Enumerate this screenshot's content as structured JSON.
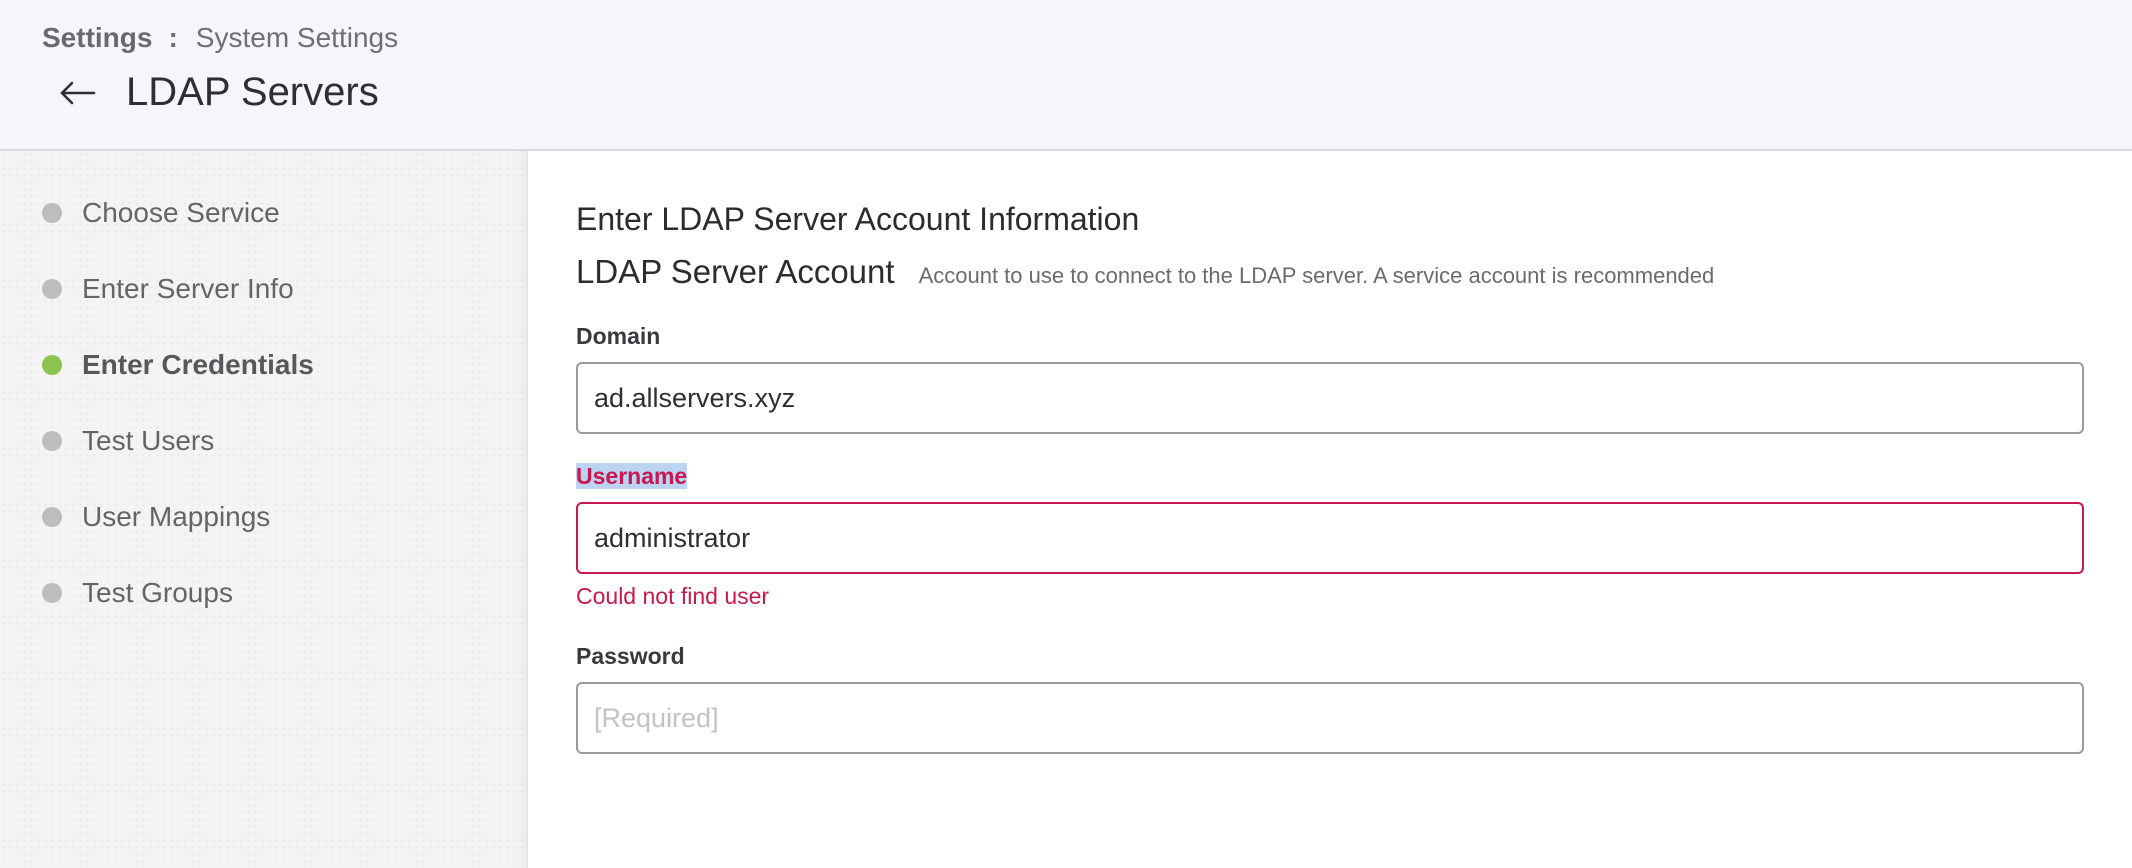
{
  "header": {
    "breadcrumb_root": "Settings",
    "breadcrumb_separator": ":",
    "breadcrumb_current": "System Settings",
    "title": "LDAP Servers",
    "back_icon": "arrow-left-icon"
  },
  "sidebar": {
    "steps": [
      {
        "label": "Choose Service",
        "active": false
      },
      {
        "label": "Enter Server Info",
        "active": false
      },
      {
        "label": "Enter Credentials",
        "active": true
      },
      {
        "label": "Test Users",
        "active": false
      },
      {
        "label": "User Mappings",
        "active": false
      },
      {
        "label": "Test Groups",
        "active": false
      }
    ]
  },
  "main": {
    "section_title": "Enter LDAP Server Account Information",
    "account_title": "LDAP Server Account",
    "account_desc": "Account to use to connect to the LDAP server. A service account is recommended",
    "fields": {
      "domain": {
        "label": "Domain",
        "value": "ad.allservers.xyz"
      },
      "username": {
        "label": "Username",
        "value": "administrator",
        "error": "Could not find user"
      },
      "password": {
        "label": "Password",
        "value": "",
        "placeholder": "[Required]"
      }
    }
  },
  "colors": {
    "active_step": "#8dc44f",
    "inactive_step": "#bdbdbd",
    "error": "#c8184f",
    "header_bg": "#f5f6f9"
  }
}
